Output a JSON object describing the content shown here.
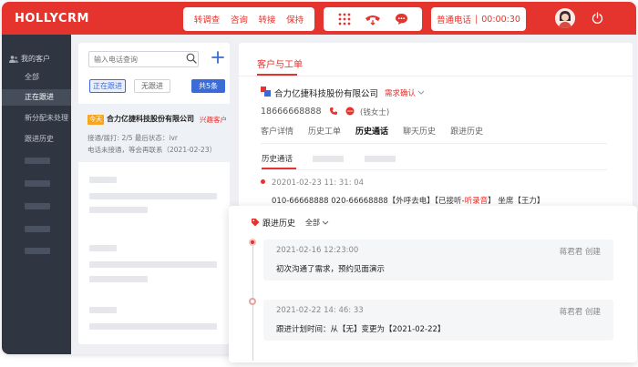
{
  "app": {
    "logo": "HOLLYCRM"
  },
  "topbar": {
    "menu": [
      "转调查",
      "咨询",
      "转接",
      "保持"
    ],
    "status": {
      "mode": "普通电话",
      "separator": "|",
      "timer": "00:00:30"
    }
  },
  "sidebar": {
    "title": "我的客户",
    "items": [
      "全部",
      "正在跟进",
      "新分配未处理",
      "跟进历史"
    ],
    "active_index": 1
  },
  "customer_list": {
    "search_placeholder": "输入电话查询",
    "filters": {
      "following": "正在跟进",
      "no_follow": "无跟进",
      "total": "共5条"
    },
    "card": {
      "tag": "今天",
      "company": "合力亿捷科技股份有限公司",
      "interest": "兴趣客户",
      "line1": "接通/拨打:  2/5   最后状态：ivr",
      "line2": "电话未接通，等会再联系（2021-02-23）"
    }
  },
  "detail": {
    "section_title": "客户与工单",
    "customer": {
      "name": "合力亿捷科技股份有限公司",
      "status": "需求确认",
      "phone": "18666668888",
      "contact": "(钱女士)"
    },
    "tabs": [
      "客户详情",
      "历史工单",
      "历史通话",
      "聊天历史",
      "跟进历史"
    ],
    "active_tab": 2,
    "subtab": "历史通话",
    "record": {
      "time": "20201-02-23  11: 31: 04",
      "text_before": "010-66668888   020-66668888【外呼去电】【已接听-",
      "text_red": "听录音",
      "text_after": "】  坐席【王力】"
    }
  },
  "followup": {
    "title": "跟进历史",
    "filter": "全部",
    "entries": [
      {
        "time": "2021-02-16  12:23:00",
        "author": "蒋君君 创建",
        "text": "初次沟通了需求，预约见面演示"
      },
      {
        "time": "2021-02-22  14: 46: 33",
        "author": "蒋君君 创建",
        "text": "跟进计划时间：从【无】变更为【2021-02-22】"
      }
    ]
  },
  "colors": {
    "brand_red": "#e5332d",
    "sidebar_bg": "#2f3541",
    "accent_blue": "#3b6bd6"
  }
}
